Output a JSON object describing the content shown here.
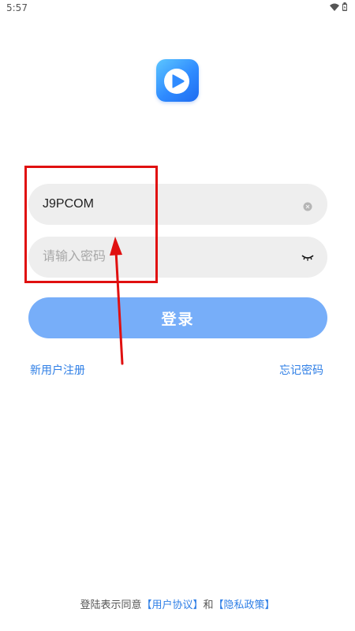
{
  "status_bar": {
    "time": "5:57",
    "icons": [
      "wifi-icon",
      "battery-icon"
    ]
  },
  "logo": {
    "icon": "play-icon",
    "colors": {
      "gradient_start": "#5cc6ff",
      "gradient_end": "#1f6bf0"
    }
  },
  "login_form": {
    "username_value": "J9PCOM",
    "username_placeholder": "",
    "username_clear_icon": "clear-icon",
    "password_value": "",
    "password_placeholder": "请输入密码",
    "password_visibility_icon": "eye-closed-icon",
    "submit_label": "登录",
    "submit_color": "#77aef9"
  },
  "links": {
    "register": "新用户注册",
    "forgot_password": "忘记密码",
    "color": "#2f7fe6"
  },
  "agreement": {
    "prefix": "登陆表示同意",
    "user_agreement": "【用户协议】",
    "conjunction": "和",
    "privacy_policy": "【隐私政策】"
  },
  "annotation": {
    "color": "#e01010"
  }
}
